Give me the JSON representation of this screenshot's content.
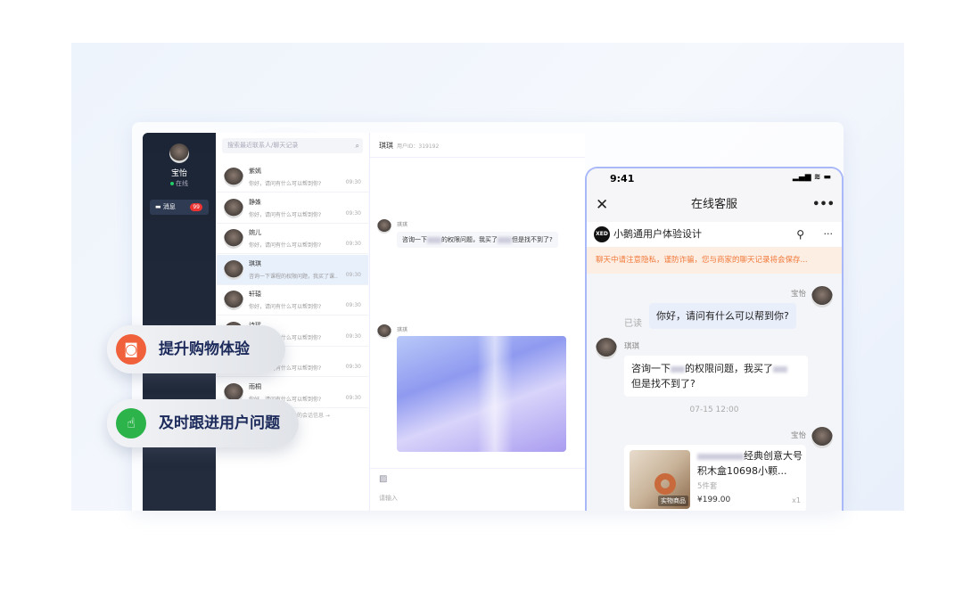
{
  "sidebar": {
    "user": "宝怡",
    "status": "在线",
    "messages_label": "消息",
    "messages_badge": "99"
  },
  "contacts": {
    "search_placeholder": "搜索最近联系人/聊天记录",
    "items": [
      {
        "name": "紫嫣",
        "preview": "你好，请问有什么可以帮到你?",
        "time": "09:30"
      },
      {
        "name": "静姝",
        "preview": "你好，请问有什么可以帮到你?",
        "time": "09:30"
      },
      {
        "name": "婉儿",
        "preview": "你好，请问有什么可以帮到你?",
        "time": "09:30"
      },
      {
        "name": "琪琪",
        "preview": "咨询一下课程的权限问题，我买了课...",
        "time": "09:30",
        "selected": true
      },
      {
        "name": "轩辕",
        "preview": "你好，请问有什么可以帮到你?",
        "time": "09:30"
      },
      {
        "name": "诗瑶",
        "preview": "你好，请问有什么可以帮到你?",
        "time": "09:30"
      },
      {
        "name": "",
        "preview": "你好，请问有什么可以帮到你?",
        "time": "09:30"
      },
      {
        "name": "雨桐",
        "preview": "你好，请问有什么可以帮到你?",
        "time": "09:30"
      }
    ],
    "more": "的会话信息 →"
  },
  "chat": {
    "name": "琪琪",
    "user_id": "用户ID：319192",
    "sender": "琪琪",
    "msg_a": "咨询一下",
    "msg_b": "的权限问题，我买了",
    "msg_c": "但是找不到了?",
    "input_placeholder": "请输入"
  },
  "phone": {
    "time": "9:41",
    "signal": "▂▄▆ ≋ ▬",
    "title": "在线客服",
    "shop_logo": "XED",
    "shop_name": "小鹅通用户体验设计",
    "notice": "聊天中请注意隐私，谨防诈骗，您与商家的聊天记录将会保存...",
    "agent": "宝怡",
    "greeting": "你好，请问有什么可以帮到你?",
    "read": "已读",
    "customer": "琪琪",
    "q_a": "咨询一下",
    "q_b": "的权限问题，我买了",
    "q_c": "但是找不到了?",
    "timestamp": "07-15 12:00",
    "product": {
      "title": "经典创意大号积木盒10698小颗...",
      "qty_label": "5件套",
      "tag": "实物商品",
      "price": "¥199.00",
      "count": "x1"
    }
  },
  "features": [
    {
      "label": "提升购物体验",
      "color": "#f0603a"
    },
    {
      "label": "及时跟进用户问题",
      "color": "#2cb34a"
    }
  ]
}
